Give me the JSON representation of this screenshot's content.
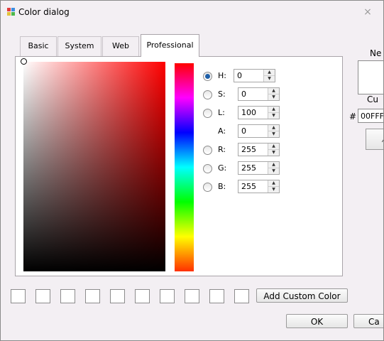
{
  "window": {
    "title": "Color dialog",
    "close_glyph": "×"
  },
  "tabs": [
    {
      "label": "Basic"
    },
    {
      "label": "System"
    },
    {
      "label": "Web"
    },
    {
      "label": "Professional"
    }
  ],
  "active_tab": "Professional",
  "fields": {
    "h": {
      "label": "H:",
      "value": "0",
      "checked": true
    },
    "s": {
      "label": "S:",
      "value": "0",
      "checked": false
    },
    "l": {
      "label": "L:",
      "value": "100",
      "checked": false
    },
    "a": {
      "label": "A:",
      "value": "0"
    },
    "r": {
      "label": "R:",
      "value": "255",
      "checked": false
    },
    "g": {
      "label": "G:",
      "value": "255",
      "checked": false
    },
    "b": {
      "label": "B:",
      "value": "255",
      "checked": false
    }
  },
  "spin_glyphs": {
    "up": "▲",
    "down": "▼"
  },
  "right_panel": {
    "new_label": "Ne",
    "current_label": "Cu",
    "hash_label": "#",
    "hex_value": "00FFF",
    "picker_glyph": "⁄"
  },
  "buttons": {
    "add_custom_color": "Add Custom Color",
    "ok": "OK",
    "cancel": "Ca"
  },
  "colors": {
    "hue_top": "#ff0000",
    "accent": "#1f5fa8"
  }
}
